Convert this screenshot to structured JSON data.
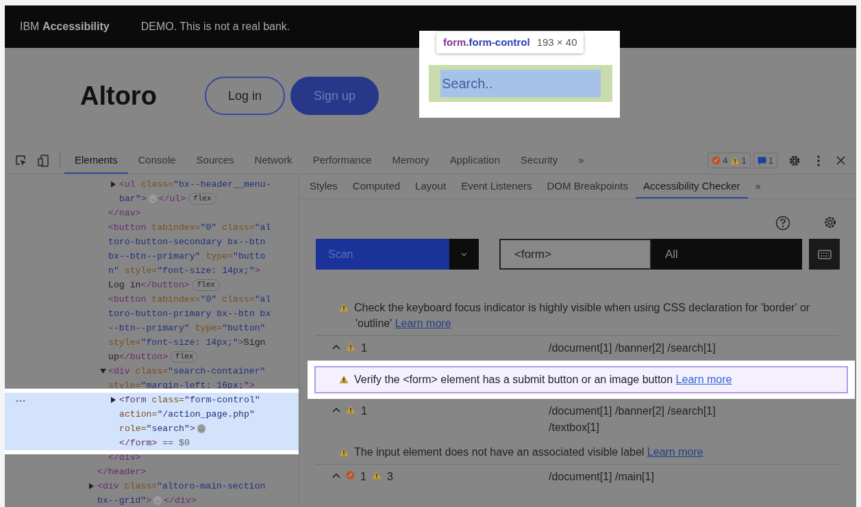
{
  "banner": {
    "brand": "IBM **Accessibility**",
    "notice": "DEMO. This is not a real bank."
  },
  "page": {
    "logo": "Altoro",
    "buttons": [
      {
        "label": "Log in",
        "kind": "outline"
      },
      {
        "label": "Sign up",
        "kind": "filled"
      }
    ],
    "search": {
      "placeholder": "Search.."
    }
  },
  "inspect_tooltip": {
    "tag": "form",
    "class_name": ".form-control",
    "size": "193 × 40"
  },
  "devtools": {
    "tabs": [
      {
        "label": "Elements",
        "selected": true
      },
      {
        "label": "Console",
        "selected": false
      },
      {
        "label": "Sources",
        "selected": false
      },
      {
        "label": "Network",
        "selected": false
      },
      {
        "label": "Performance",
        "selected": false
      },
      {
        "label": "Memory",
        "selected": false
      },
      {
        "label": "Application",
        "selected": false
      },
      {
        "label": "Security",
        "selected": false
      }
    ],
    "more_tabs": "»",
    "counts": [
      {
        "kind": "error",
        "count": "4"
      },
      {
        "kind": "warning",
        "count": "1"
      },
      {
        "kind": "message",
        "count": "1"
      }
    ]
  },
  "elements_tree": [
    {
      "closing": "</header>",
      "children": [
        {
          "closing": "</nav>",
          "children": [
            {
              "expanded": false,
              "lines": [
                [
                  {
                    "kind": "tag",
                    "text": "<ul "
                  },
                  {
                    "kind": "attr",
                    "text": "class="
                  },
                  {
                    "kind": "value",
                    "text": "\"bx--header__menu-"
                  }
                ],
                [
                  {
                    "kind": "value",
                    "text": "bar\""
                  },
                  {
                    "kind": "tag",
                    "text": ">"
                  },
                  {
                    "kind": "ellipsis",
                    "text": "…"
                  },
                  {
                    "kind": "tag",
                    "text": "</ul>"
                  },
                  {
                    "kind": "badge",
                    "text": "flex"
                  }
                ]
              ]
            }
          ]
        },
        {
          "lines": [
            [
              {
                "kind": "tag",
                "text": "<button "
              },
              {
                "kind": "attr",
                "text": "tabindex="
              },
              {
                "kind": "value",
                "text": "\"0\" "
              },
              {
                "kind": "attr",
                "text": "class="
              },
              {
                "kind": "value",
                "text": "\"al"
              }
            ],
            [
              {
                "kind": "value",
                "text": "toro-button-secondary bx--btn"
              }
            ],
            [
              {
                "kind": "value",
                "text": "bx--btn--primary\" "
              },
              {
                "kind": "attr",
                "text": "type="
              },
              {
                "kind": "value",
                "text": "\"butto"
              }
            ],
            [
              {
                "kind": "value",
                "text": "n\" "
              },
              {
                "kind": "attr",
                "text": "style="
              },
              {
                "kind": "value",
                "text": "\"font-size: 14px;\""
              },
              {
                "kind": "tag",
                "text": ">"
              }
            ],
            [
              {
                "kind": "plain",
                "text": "Log in"
              },
              {
                "kind": "tag",
                "text": "</button>"
              },
              {
                "kind": "badge",
                "text": "flex"
              }
            ]
          ]
        },
        {
          "lines": [
            [
              {
                "kind": "tag",
                "text": "<button "
              },
              {
                "kind": "attr",
                "text": "tabindex="
              },
              {
                "kind": "value",
                "text": "\"0\" "
              },
              {
                "kind": "attr",
                "text": "class="
              },
              {
                "kind": "value",
                "text": "\"al"
              }
            ],
            [
              {
                "kind": "value",
                "text": "toro-button-primary bx--btn bx"
              }
            ],
            [
              {
                "kind": "value",
                "text": "--btn--primary\" "
              },
              {
                "kind": "attr",
                "text": "type="
              },
              {
                "kind": "value",
                "text": "\"button\""
              }
            ],
            [
              {
                "kind": "attr",
                "text": "style="
              },
              {
                "kind": "value",
                "text": "\"font-size: 14px;\""
              },
              {
                "kind": "tag",
                "text": ">"
              },
              {
                "kind": "plain",
                "text": "Sign"
              }
            ],
            [
              {
                "kind": "plain",
                "text": "up"
              },
              {
                "kind": "tag",
                "text": "</button>"
              },
              {
                "kind": "badge",
                "text": "flex"
              }
            ]
          ]
        },
        {
          "expanded": true,
          "lines": [
            [
              {
                "kind": "tag",
                "text": "<div "
              },
              {
                "kind": "attr",
                "text": "class="
              },
              {
                "kind": "value",
                "text": "\"search-container\""
              }
            ],
            [
              {
                "kind": "attr",
                "text": "style="
              },
              {
                "kind": "value",
                "text": "\"margin-left: 16px;\""
              },
              {
                "kind": "tag",
                "text": ">"
              }
            ]
          ],
          "closing": "</div>",
          "children": [
            {
              "expanded": false,
              "selected": true,
              "lines": [
                [
                  {
                    "kind": "tag",
                    "text": "<form "
                  },
                  {
                    "kind": "attr",
                    "text": "class="
                  },
                  {
                    "kind": "value",
                    "text": "\"form-control\""
                  }
                ],
                [
                  {
                    "kind": "attr",
                    "text": "action="
                  },
                  {
                    "kind": "value",
                    "text": "\"/action_page.php\""
                  }
                ],
                [
                  {
                    "kind": "attr",
                    "text": "role="
                  },
                  {
                    "kind": "value",
                    "text": "\"search\""
                  },
                  {
                    "kind": "tag",
                    "text": ">"
                  },
                  {
                    "kind": "ellipsis",
                    "text": "…"
                  }
                ],
                [
                  {
                    "kind": "tag",
                    "text": "</form>"
                  },
                  {
                    "kind": "ref",
                    "text": " == $0"
                  }
                ]
              ]
            }
          ]
        }
      ]
    },
    {
      "expanded": false,
      "lines": [
        [
          {
            "kind": "tag",
            "text": "<div "
          },
          {
            "kind": "attr",
            "text": "class="
          },
          {
            "kind": "value",
            "text": "\"altoro-main-section"
          }
        ],
        [
          {
            "kind": "value",
            "text": "bx--grid\""
          },
          {
            "kind": "tag",
            "text": ">"
          },
          {
            "kind": "ellipsis",
            "text": "…"
          },
          {
            "kind": "tag",
            "text": "</div>"
          }
        ]
      ]
    }
  ],
  "sidebar": {
    "tabs": [
      {
        "label": "Styles",
        "selected": false
      },
      {
        "label": "Computed",
        "selected": false
      },
      {
        "label": "Layout",
        "selected": false
      },
      {
        "label": "Event Listeners",
        "selected": false
      },
      {
        "label": "DOM Breakpoints",
        "selected": false
      },
      {
        "label": "Accessibility Checker",
        "selected": true
      }
    ],
    "more_tabs": "»"
  },
  "checker": {
    "scan_button": "Scan",
    "filter": {
      "value": "<form>"
    },
    "level_dropdown": "All",
    "items": [
      {
        "kind": "issue",
        "selected": false,
        "text": "Check the keyboard focus indicator is highly visible when using CSS declaration for 'border' or 'outline'",
        "link": "Learn more"
      },
      {
        "kind": "group",
        "counts": [
          {
            "kind": "warning",
            "count": "1"
          }
        ],
        "path": "/document[1] /banner[2] /search[1]"
      },
      {
        "kind": "issue",
        "selected": true,
        "text": "Verify the <form> element has a submit button or an image button",
        "link": "Learn more"
      },
      {
        "kind": "group",
        "counts": [
          {
            "kind": "warning",
            "count": "1"
          }
        ],
        "path": "/document[1] /banner[2] /search[1] /textbox[1]"
      },
      {
        "kind": "issue",
        "selected": false,
        "text": "The input element does not have an associated visible label",
        "link": "Learn more"
      },
      {
        "kind": "group",
        "counts": [
          {
            "kind": "error",
            "count": "1"
          },
          {
            "kind": "warning",
            "count": "3"
          }
        ],
        "path": "/document[1] /main[1]"
      }
    ]
  }
}
